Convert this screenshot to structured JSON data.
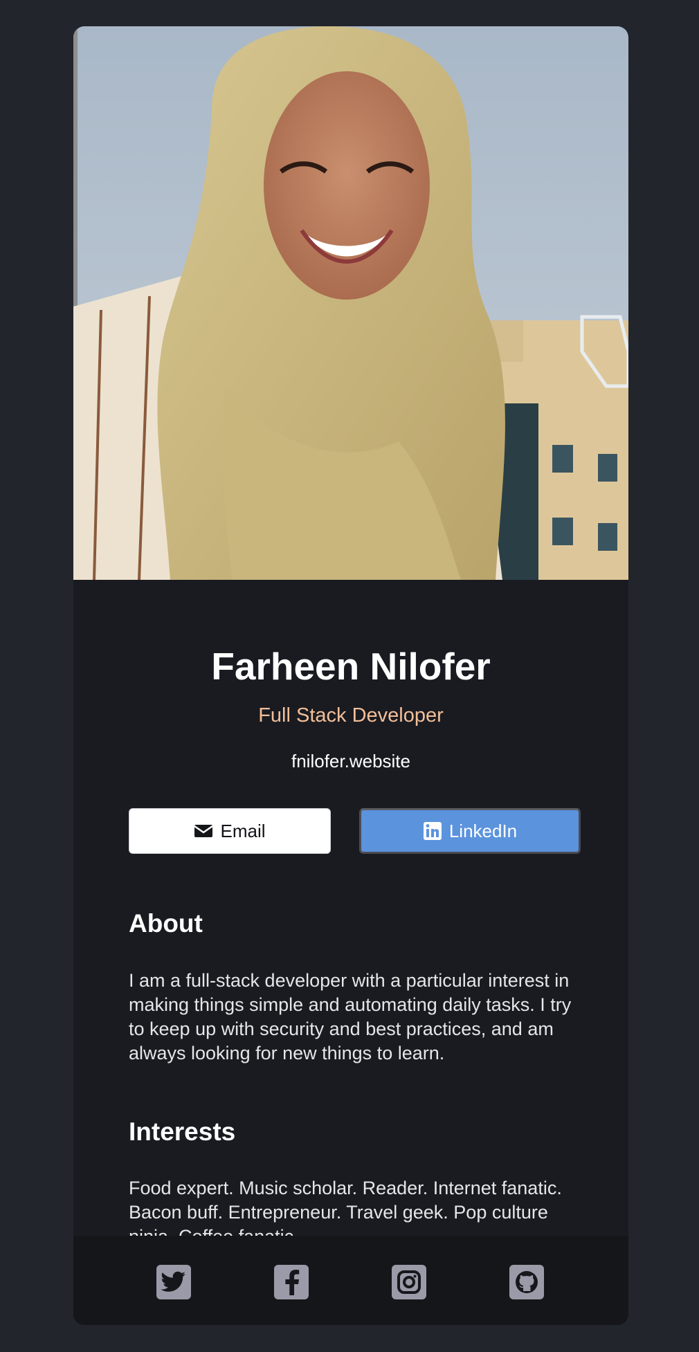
{
  "profile": {
    "name": "Farheen Nilofer",
    "title": "Full Stack Developer",
    "website": "fnilofer.website"
  },
  "buttons": {
    "email_label": "Email",
    "linkedin_label": "LinkedIn"
  },
  "about": {
    "heading": "About",
    "text": "I am a full-stack developer with a particular interest in making things simple and automating daily tasks. I try to keep up with security and best practices, and am always looking for new things to learn."
  },
  "interests": {
    "heading": "Interests",
    "text": "Food expert. Music scholar. Reader. Internet fanatic. Bacon buff. Entrepreneur. Travel geek. Pop culture ninja. Coffee fanatic."
  },
  "social": [
    {
      "icon": "twitter-icon"
    },
    {
      "icon": "facebook-icon"
    },
    {
      "icon": "instagram-icon"
    },
    {
      "icon": "github-icon"
    }
  ],
  "colors": {
    "page_background": "#23252c",
    "card_background": "#1a1b21",
    "footer_background": "#151619",
    "accent": "#f3bf99",
    "linkedin_blue": "#5b93dd",
    "social_icon": "#9a9aa8"
  }
}
